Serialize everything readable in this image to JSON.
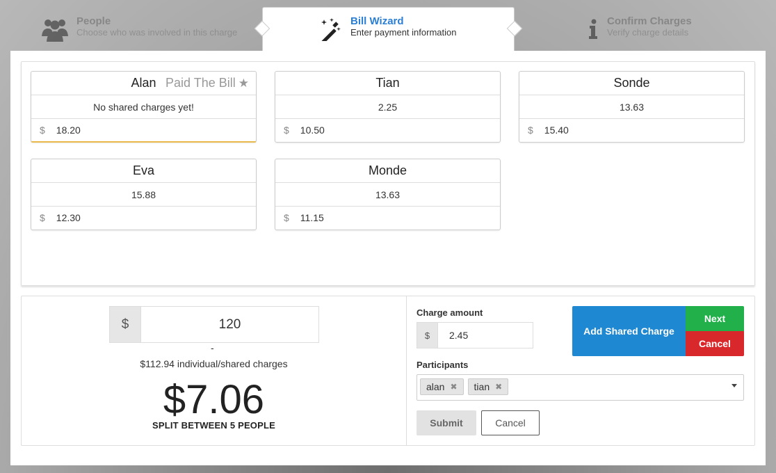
{
  "steps": [
    {
      "title": "People",
      "subtitle": "Choose who was involved in this charge",
      "icon": "people-icon"
    },
    {
      "title": "Bill Wizard",
      "subtitle": "Enter payment information",
      "icon": "magic-wand-icon"
    },
    {
      "title": "Confirm Charges",
      "subtitle": "Verify charge details",
      "icon": "info-icon"
    }
  ],
  "cards": [
    {
      "name": "Alan",
      "paid_label": "Paid The Bill",
      "shared": "No shared charges yet!",
      "currency": "$",
      "amount": "18.20"
    },
    {
      "name": "Tian",
      "shared": "2.25",
      "currency": "$",
      "amount": "10.50"
    },
    {
      "name": "Sonde",
      "shared": "13.63",
      "currency": "$",
      "amount": "15.40"
    },
    {
      "name": "Eva",
      "shared": "15.88",
      "currency": "$",
      "amount": "12.30"
    },
    {
      "name": "Monde",
      "shared": "13.63",
      "currency": "$",
      "amount": "11.15"
    }
  ],
  "summary": {
    "currency": "$",
    "bill_total": "120",
    "dash": "-",
    "charges_text": "$112.94 individual/shared charges",
    "split_amount": "$7.06",
    "split_label": "SPLIT BETWEEN 5 PEOPLE"
  },
  "form": {
    "charge_label": "Charge amount",
    "charge_currency": "$",
    "charge_value": "2.45",
    "participants_label": "Participants",
    "participants": [
      "alan",
      "tian"
    ],
    "remove_glyph": "✖",
    "submit": "Submit",
    "cancel": "Cancel"
  },
  "actions": {
    "add_shared": "Add Shared Charge",
    "next": "Next",
    "cancel": "Cancel"
  },
  "colors": {
    "accent_blue": "#1f88d2",
    "next_green": "#21b04a",
    "cancel_red": "#d9282c",
    "payer_highlight": "#e8b84a"
  }
}
